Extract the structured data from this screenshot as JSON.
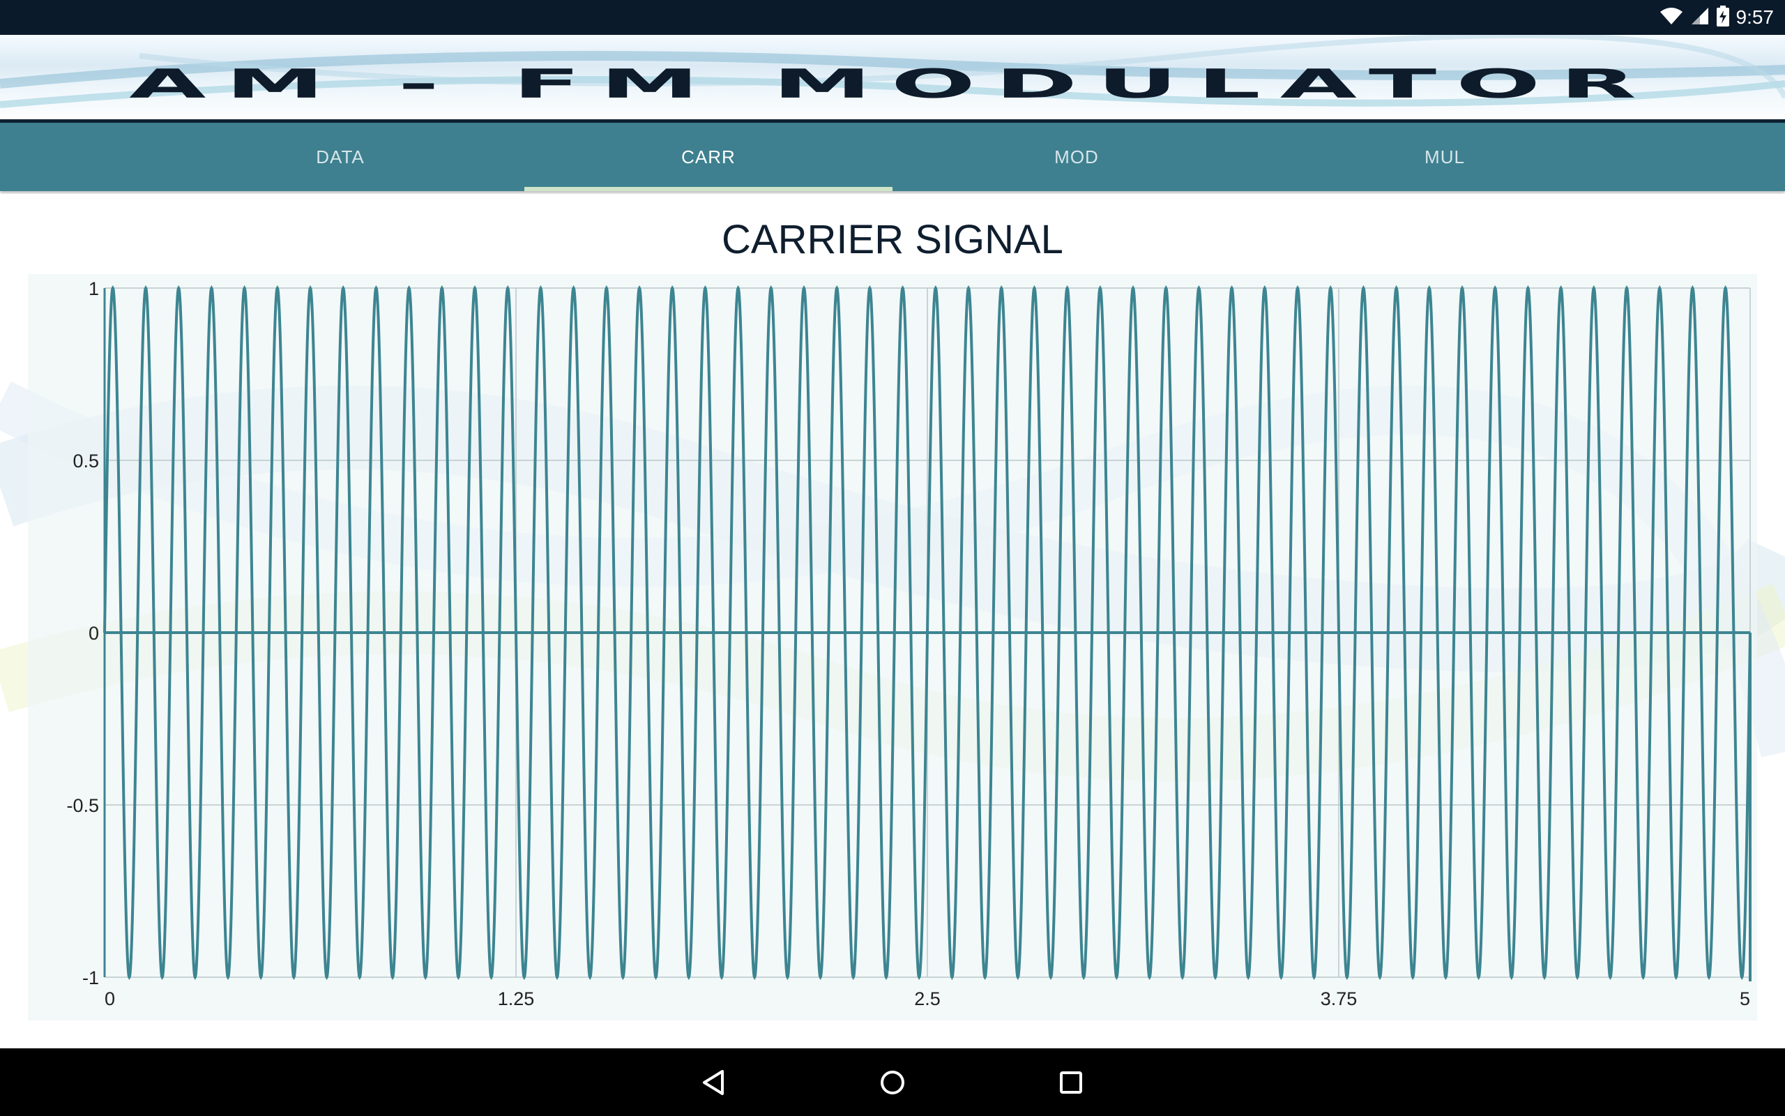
{
  "status_bar": {
    "time": "9:57",
    "icons": [
      "wifi-icon",
      "cell-signal-icon",
      "battery-charging-icon"
    ]
  },
  "banner": {
    "title": "AM - FM MODULATOR"
  },
  "tabs": [
    {
      "label": "DATA",
      "active": false
    },
    {
      "label": "CARR",
      "active": true
    },
    {
      "label": "MOD",
      "active": false
    },
    {
      "label": "MUL",
      "active": false
    }
  ],
  "colors": {
    "accent": "#3e808f",
    "indicator": "#cfe7c8",
    "series": "#3c8591"
  },
  "chart_data": {
    "type": "line",
    "title": "CARRIER SIGNAL",
    "xlabel": "",
    "ylabel": "",
    "xlim": [
      0,
      5
    ],
    "ylim": [
      -1,
      1
    ],
    "x_ticks": [
      "0",
      "1.25",
      "2.5",
      "3.75",
      "5"
    ],
    "y_ticks": [
      "1",
      "0.5",
      "0",
      "-0.5",
      "-1"
    ],
    "grid": true,
    "series": [
      {
        "function": "sin",
        "amplitude": 1,
        "cycles": 50,
        "x_start": 0,
        "x_end": 5
      }
    ]
  },
  "nav_bar": {
    "icons": [
      "back-icon",
      "home-icon",
      "recents-icon"
    ]
  }
}
